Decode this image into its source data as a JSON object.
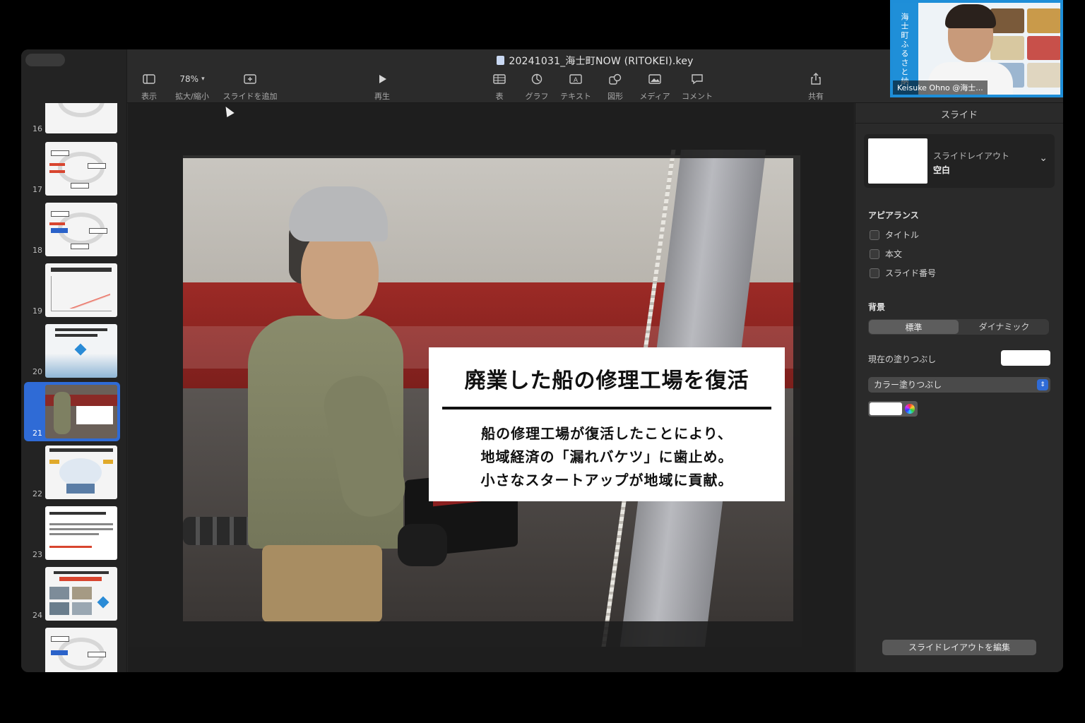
{
  "window": {
    "title": "20241031_海士町NOW (RITOKEI).key"
  },
  "toolbar": {
    "view": "表示",
    "zoom_value": "78%",
    "zoom": "拡大/縮小",
    "add_slide": "スライドを追加",
    "play": "再生",
    "table": "表",
    "chart": "グラフ",
    "text": "テキスト",
    "shape": "図形",
    "media": "メディア",
    "comment": "コメント",
    "share": "共有"
  },
  "sidebar": {
    "slides": [
      {
        "number": "16"
      },
      {
        "number": "17"
      },
      {
        "number": "18"
      },
      {
        "number": "19"
      },
      {
        "number": "20"
      },
      {
        "number": "21",
        "selected": true
      },
      {
        "number": "22"
      },
      {
        "number": "23"
      },
      {
        "number": "24"
      }
    ]
  },
  "slide": {
    "heading": "廃業した船の修理工場を復活",
    "lines": [
      "船の修理工場が復活したことにより、",
      "地域経済の「漏れバケツ」に歯止め。",
      "小さなスタートアップが地域に貢献。"
    ]
  },
  "inspector": {
    "tab": "スライド",
    "layout_label": "スライドレイアウト",
    "layout_value": "空白",
    "appearance_label": "アピアランス",
    "appearance_options": [
      "タイトル",
      "本文",
      "スライド番号"
    ],
    "background_label": "背景",
    "bg_standard": "標準",
    "bg_dynamic": "ダイナミック",
    "current_fill": "現在の塗りつぶし",
    "fill_type": "カラー塗りつぶし",
    "edit_layout": "スライドレイアウトを編集"
  },
  "webcam": {
    "name": "Keisuke Ohno @海士...",
    "banner": "海士町ふるさと納"
  },
  "colors": {
    "accent": "#2f6bd6",
    "window_bg": "#262626",
    "slide_red": "#9c2a26"
  }
}
